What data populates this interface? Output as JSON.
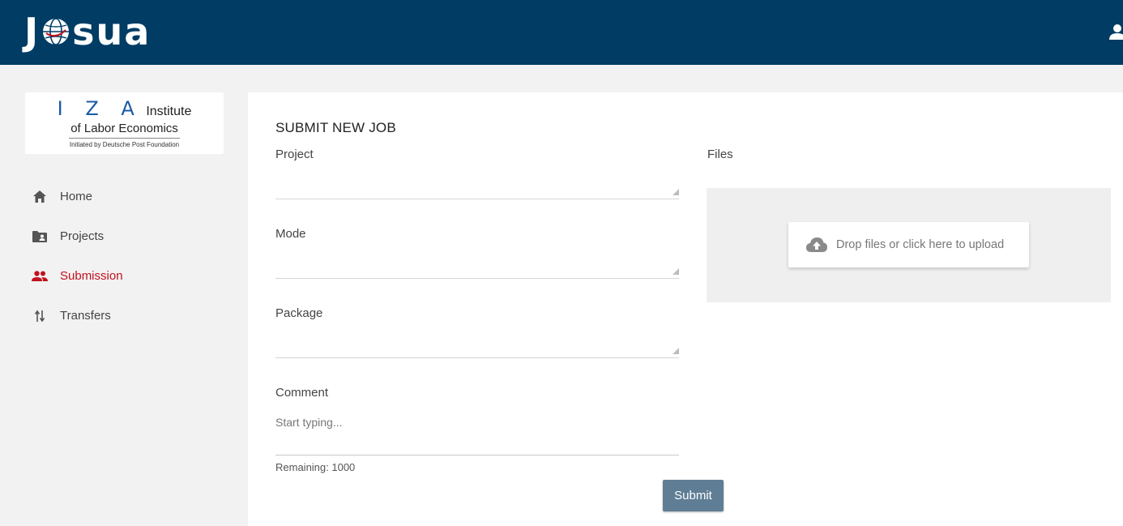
{
  "header": {
    "brand_left": "J",
    "brand_right": "SUA",
    "brand_globe_icon": "globe-icon",
    "user_icon": "user-icon",
    "background": "#003c64"
  },
  "sidebar": {
    "logo": {
      "letters": "I Z A",
      "line1_suffix": "Institute",
      "line2": "of Labor Economics",
      "line3": "Initiated by Deutsche Post Foundation"
    },
    "items": [
      {
        "label": "Home",
        "icon": "home-icon",
        "active": false
      },
      {
        "label": "Projects",
        "icon": "folder-icon",
        "active": false
      },
      {
        "label": "Submission",
        "icon": "group-icon",
        "active": true
      },
      {
        "label": "Transfers",
        "icon": "transfer-arrows-icon",
        "active": false
      }
    ],
    "active_color": "#c1121f"
  },
  "form": {
    "title": "SUBMIT NEW JOB",
    "project_label": "Project",
    "mode_label": "Mode",
    "package_label": "Package",
    "comment_label": "Comment",
    "comment_placeholder": "Start typing...",
    "remaining": "Remaining: 1000",
    "files_label": "Files",
    "upload_text": "Drop files or click here to upload",
    "upload_icon": "cloud-upload-icon",
    "submit_label": "Submit",
    "submit_color": "#5f7e95"
  }
}
